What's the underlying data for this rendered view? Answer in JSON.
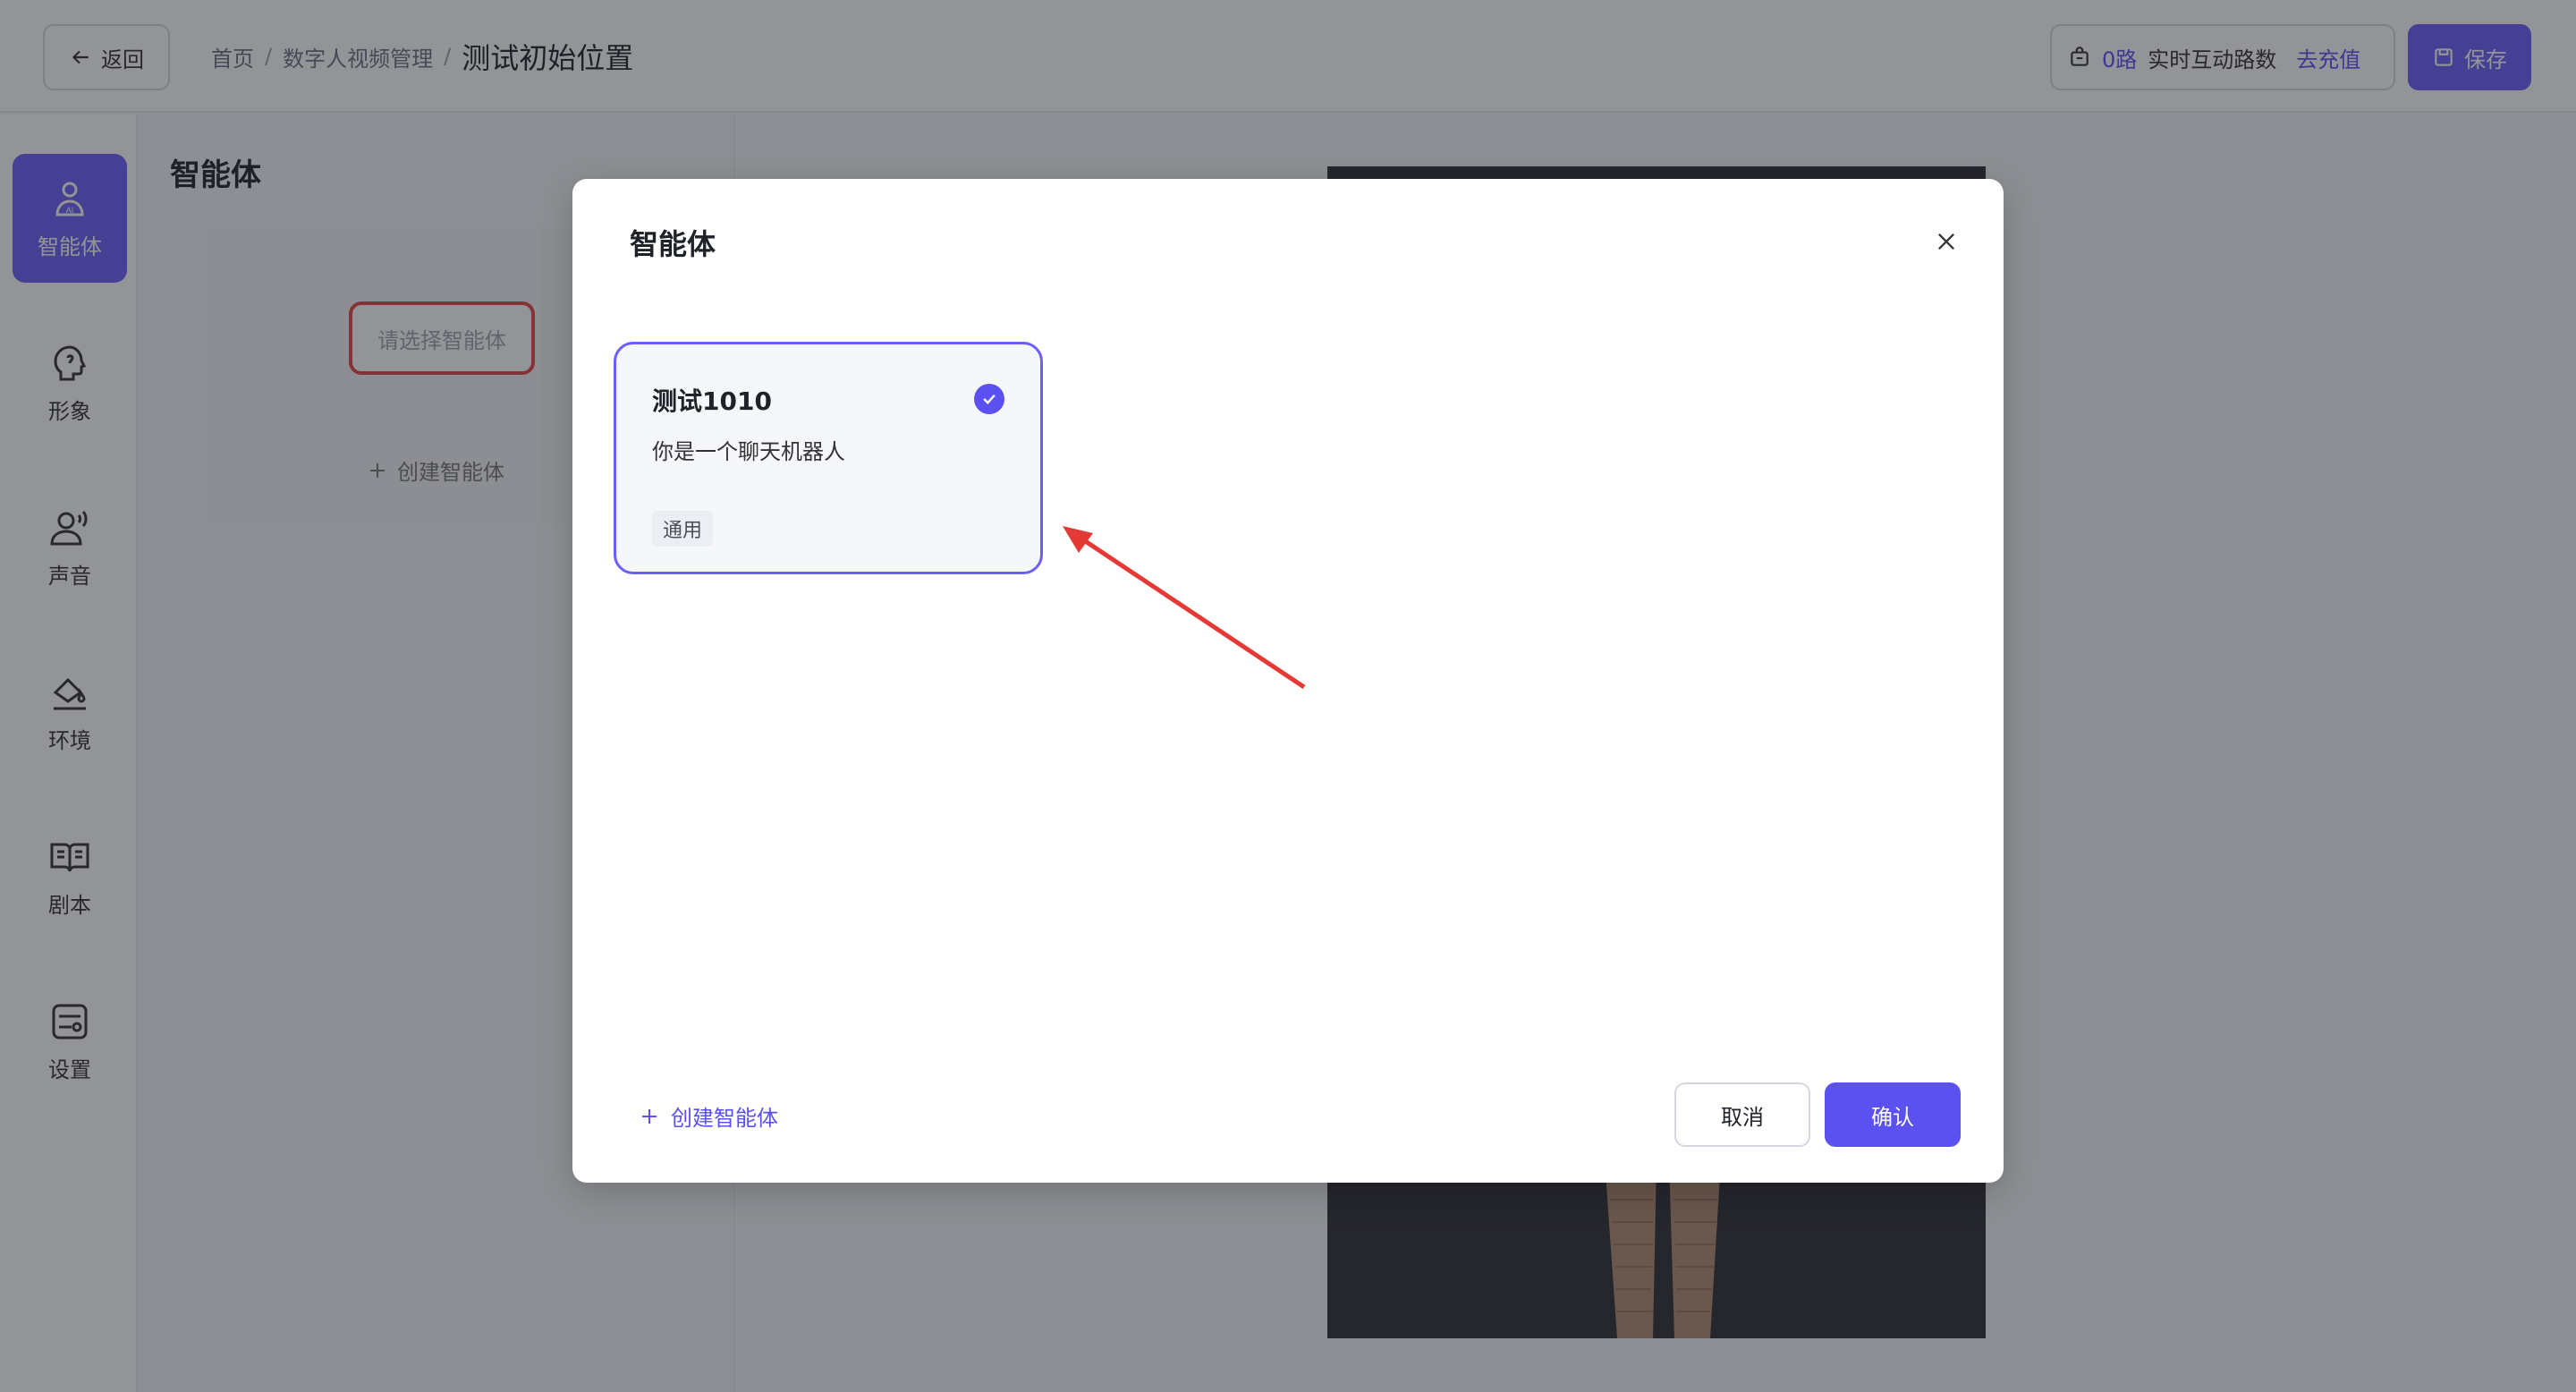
{
  "header": {
    "back_label": "返回",
    "breadcrumb": [
      "首页",
      "数字人视频管理",
      "测试初始位置"
    ],
    "breadcrumb_separator": "/",
    "quota_count": "0路",
    "quota_label": "实时互动路数",
    "quota_link": "去充值",
    "save_label": "保存"
  },
  "sidenav": {
    "items": [
      {
        "label": "智能体",
        "icon": "agent-icon",
        "active": true
      },
      {
        "label": "形象",
        "icon": "avatar-shape-icon",
        "active": false
      },
      {
        "label": "声音",
        "icon": "voice-icon",
        "active": false
      },
      {
        "label": "环境",
        "icon": "paint-bucket-icon",
        "active": false
      },
      {
        "label": "剧本",
        "icon": "book-icon",
        "active": false
      },
      {
        "label": "设置",
        "icon": "settings-icon",
        "active": false
      }
    ]
  },
  "content": {
    "title": "智能体",
    "select_placeholder": "请选择智能体",
    "create_label": "创建智能体"
  },
  "modal": {
    "title": "智能体",
    "agents": [
      {
        "name": "测试1010",
        "description": "你是一个聊天机器人",
        "tag": "通用",
        "selected": true
      }
    ],
    "create_label": "创建智能体",
    "cancel_label": "取消",
    "confirm_label": "确认"
  },
  "colors": {
    "accent": "#5b50f0",
    "highlight_annotation": "#e54545"
  }
}
